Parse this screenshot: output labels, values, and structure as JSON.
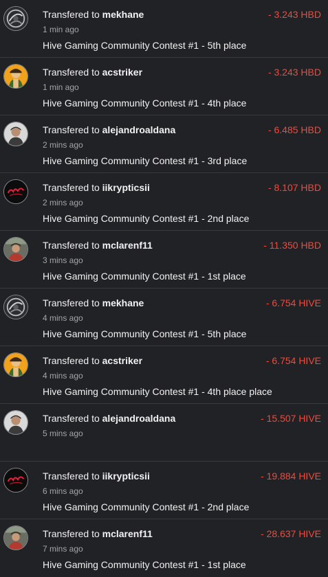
{
  "colors": {
    "background": "#212226",
    "divider": "#3a3b40",
    "amount_negative": "#ef4b3c",
    "secondary_text": "#a4a5aa"
  },
  "transfers": [
    {
      "prefix": "Transfered to",
      "user": "mekhane",
      "time": "1 min ago",
      "memo": "Hive Gaming Community Contest #1 - 5th place",
      "amount": "- 3.243 HBD",
      "avatar": "mekhane"
    },
    {
      "prefix": "Transfered to",
      "user": "acstriker",
      "time": "1 min ago",
      "memo": "Hive Gaming Community Contest #1 - 4th place",
      "amount": "- 3.243 HBD",
      "avatar": "acstriker"
    },
    {
      "prefix": "Transfered to",
      "user": "alejandroaldana",
      "time": "2 mins ago",
      "memo": "Hive Gaming Community Contest #1 - 3rd place",
      "amount": "- 6.485 HBD",
      "avatar": "alejandroaldana"
    },
    {
      "prefix": "Transfered to",
      "user": "iikrypticsii",
      "time": "2 mins ago",
      "memo": "Hive Gaming Community Contest #1 - 2nd place",
      "amount": "- 8.107 HBD",
      "avatar": "iikrypticsii"
    },
    {
      "prefix": "Transfered to",
      "user": "mclarenf11",
      "time": "3 mins ago",
      "memo": "Hive Gaming Community Contest #1 - 1st place",
      "amount": "- 11.350 HBD",
      "avatar": "mclarenf11"
    },
    {
      "prefix": "Transfered to",
      "user": "mekhane",
      "time": "4 mins ago",
      "memo": "Hive Gaming Community Contest #1 - 5th place",
      "amount": "- 6.754 HIVE",
      "avatar": "mekhane"
    },
    {
      "prefix": "Transfered to",
      "user": "acstriker",
      "time": "4 mins ago",
      "memo": "Hive Gaming Community Contest #1 - 4th place place",
      "amount": "- 6.754 HIVE",
      "avatar": "acstriker"
    },
    {
      "prefix": "Transfered to",
      "user": "alejandroaldana",
      "time": "5 mins ago",
      "memo": "",
      "amount": "- 15.507 HIVE",
      "avatar": "alejandroaldana"
    },
    {
      "prefix": "Transfered to",
      "user": "iikrypticsii",
      "time": "6 mins ago",
      "memo": "Hive Gaming Community Contest #1 - 2nd place",
      "amount": "- 19.884 HIVE",
      "avatar": "iikrypticsii"
    },
    {
      "prefix": "Transfered to",
      "user": "mclarenf11",
      "time": "7 mins ago",
      "memo": "Hive Gaming Community Contest #1 - 1st place",
      "amount": "- 28.637 HIVE",
      "avatar": "mclarenf11"
    }
  ]
}
